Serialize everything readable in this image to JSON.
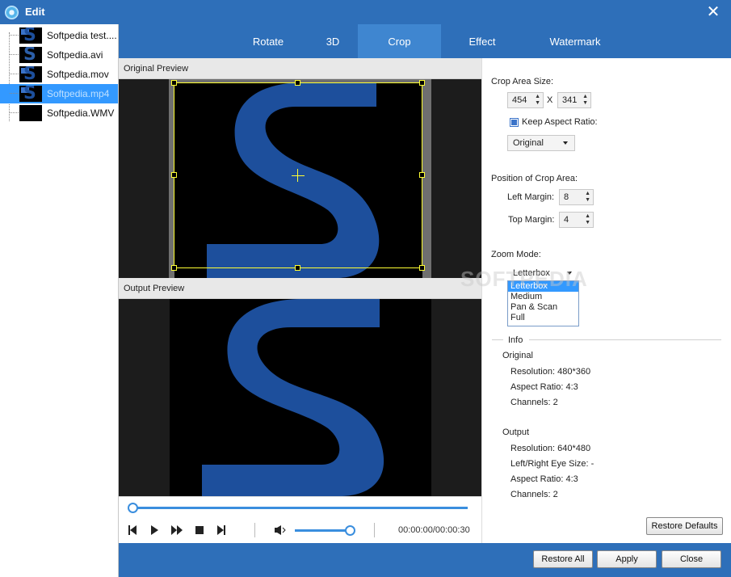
{
  "window": {
    "title": "Edit",
    "close_glyph": "✕",
    "app_icon": "app-logo-icon"
  },
  "files": [
    {
      "name": "Softpedia test....",
      "thumb": "video-thumb"
    },
    {
      "name": "Softpedia.avi",
      "thumb": "s-logo-thumb"
    },
    {
      "name": "Softpedia.mov",
      "thumb": "video-thumb"
    },
    {
      "name": "Softpedia.mp4",
      "thumb": "video-thumb",
      "selected": true
    },
    {
      "name": "Softpedia.WMV",
      "thumb": "black-thumb"
    }
  ],
  "tabs": [
    {
      "label": "Rotate"
    },
    {
      "label": "3D"
    },
    {
      "label": "Crop",
      "active": true
    },
    {
      "label": "Effect"
    },
    {
      "label": "Watermark"
    }
  ],
  "preview": {
    "original_label": "Original Preview",
    "output_label": "Output Preview",
    "logo_letter": "S"
  },
  "playback": {
    "timecode": "00:00:00/00:00:30",
    "seek_fraction": 0.0,
    "volume_fraction": 1.0,
    "icons": [
      "skip-back-icon",
      "play-icon",
      "fast-forward-icon",
      "stop-icon",
      "skip-end-icon",
      "volume-icon"
    ]
  },
  "crop": {
    "area_size_label": "Crop Area Size:",
    "width": "454",
    "x_sep": "X",
    "height": "341",
    "keep_aspect_label": "Keep Aspect Ratio:",
    "keep_aspect_checked": true,
    "aspect_value": "Original",
    "position_label": "Position of Crop Area:",
    "left_margin_label": "Left Margin:",
    "left_margin": "8",
    "top_margin_label": "Top Margin:",
    "top_margin": "4"
  },
  "zoom": {
    "label": "Zoom Mode:",
    "value": "Letterbox",
    "options": [
      "Letterbox",
      "Medium",
      "Pan & Scan",
      "Full"
    ]
  },
  "info": {
    "group_label": "Info",
    "original_label": "Original",
    "original": {
      "resolution": "Resolution: 480*360",
      "aspect": "Aspect Ratio: 4:3",
      "channels": "Channels: 2"
    },
    "output_label": "Output",
    "output": {
      "resolution": "Resolution: 640*480",
      "eye_size": "Left/Right Eye Size: -",
      "aspect": "Aspect Ratio: 4:3",
      "channels": "Channels: 2"
    }
  },
  "buttons": {
    "restore_defaults": "Restore Defaults",
    "restore_all": "Restore All",
    "apply": "Apply",
    "close": "Close"
  },
  "watermark_text": "SOFTPEDIA",
  "colors": {
    "titlebar": "#2e6fb9",
    "active_tab": "#3f86d0",
    "selection": "#3399ff",
    "crop_frame": "#ffff33",
    "logo_blue": "#1d4f9c"
  }
}
